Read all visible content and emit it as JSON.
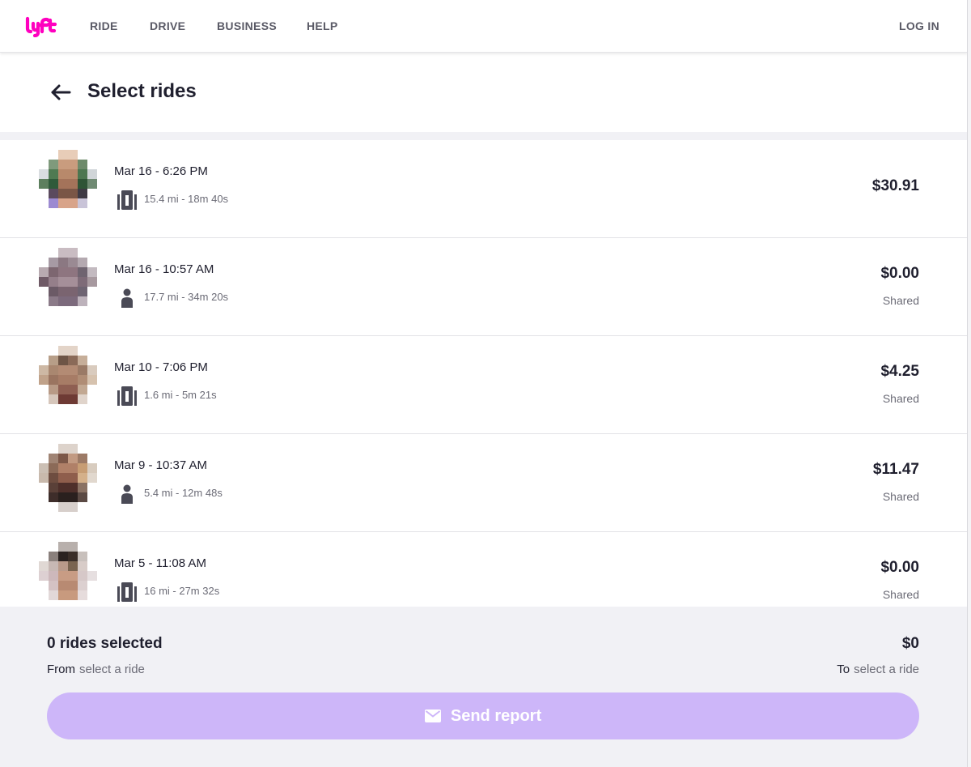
{
  "brand": {
    "logo_icon": "lyft-logo-icon",
    "accent": "#ff00bf"
  },
  "nav": {
    "items": [
      {
        "label": "RIDE"
      },
      {
        "label": "DRIVE"
      },
      {
        "label": "BUSINESS"
      },
      {
        "label": "HELP"
      }
    ],
    "login_label": "LOG IN"
  },
  "header": {
    "title": "Select rides",
    "back_icon": "arrow-left-icon"
  },
  "rides": [
    {
      "datetime": "Mar 16 - 6:26 PM",
      "ride_type_icon": "luggage-icon",
      "detail": "15.4 mi - 18m 40s",
      "price": "$30.91",
      "tag": ""
    },
    {
      "datetime": "Mar 16 - 10:57 AM",
      "ride_type_icon": "person-icon",
      "detail": "17.7 mi - 34m 20s",
      "price": "$0.00",
      "tag": "Shared"
    },
    {
      "datetime": "Mar 10 - 7:06 PM",
      "ride_type_icon": "luggage-icon",
      "detail": "1.6 mi - 5m 21s",
      "price": "$4.25",
      "tag": "Shared"
    },
    {
      "datetime": "Mar 9 - 10:37 AM",
      "ride_type_icon": "person-icon",
      "detail": "5.4 mi - 12m 48s",
      "price": "$11.47",
      "tag": "Shared"
    },
    {
      "datetime": "Mar 5 - 11:08 AM",
      "ride_type_icon": "luggage-icon",
      "detail": "16 mi - 27m 32s",
      "price": "$0.00",
      "tag": "Shared"
    }
  ],
  "footer": {
    "selected_count": "0 rides selected",
    "total": "$0",
    "from_label": "From",
    "from_placeholder": "select a ride",
    "to_label": "To",
    "to_placeholder": "select a ride",
    "send_label": "Send report",
    "send_icon": "envelope-icon",
    "send_color": "#cdb6f9"
  }
}
